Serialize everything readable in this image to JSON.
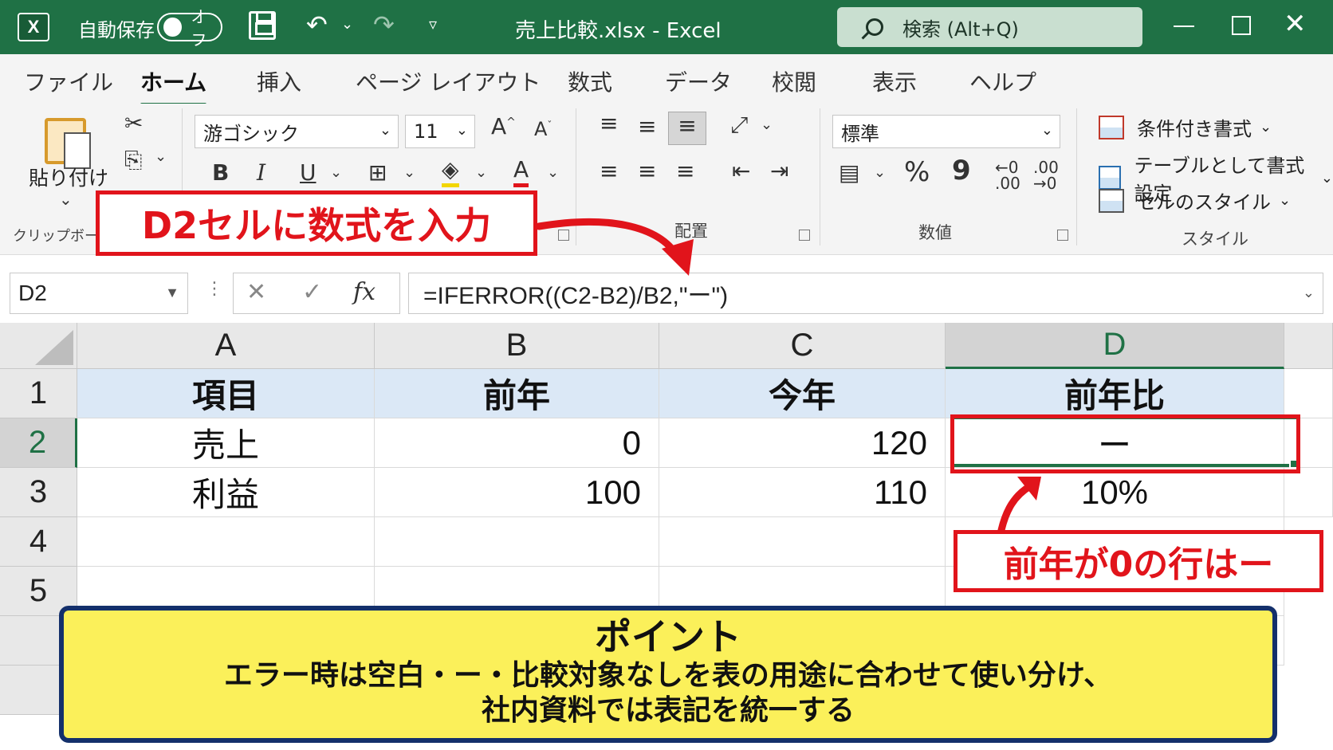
{
  "titlebar": {
    "app_icon": "X",
    "autosave_label": "自動保存",
    "autosave_state": "オフ",
    "document_title": "売上比較.xlsx  -  Excel",
    "search_placeholder": "検索 (Alt+Q)"
  },
  "ribbon": {
    "tabs": [
      "ファイル",
      "ホーム",
      "挿入",
      "ページ レイアウト",
      "数式",
      "データ",
      "校閲",
      "表示",
      "ヘルプ"
    ],
    "active_tab": "ホーム",
    "clipboard": {
      "paste_label": "貼り付け",
      "group_label": "クリップボード"
    },
    "font": {
      "font_name": "游ゴシック",
      "font_size": "11",
      "bold": "B",
      "italic": "I",
      "underline": "U"
    },
    "alignment": {
      "group_label": "配置"
    },
    "number": {
      "format": "標準",
      "percent": "%",
      "comma": "9",
      "group_label": "数値"
    },
    "styles": {
      "conditional_formatting": "条件付き書式",
      "format_as_table": "テーブルとして書式設定",
      "cell_styles": "セルのスタイル",
      "group_label": "スタイル"
    }
  },
  "formula_bar": {
    "name_box": "D2",
    "fx_label": "fx",
    "formula": "=IFERROR((C2-B2)/B2,\"ー\")"
  },
  "sheet": {
    "columns": [
      "A",
      "B",
      "C",
      "D"
    ],
    "rows": [
      "1",
      "2",
      "3",
      "4",
      "5"
    ],
    "selected_cell": "D2",
    "header_row": [
      "項目",
      "前年",
      "今年",
      "前年比"
    ],
    "data_rows": [
      [
        "売上",
        "0",
        "120",
        "ー"
      ],
      [
        "利益",
        "100",
        "110",
        "10%"
      ]
    ]
  },
  "annotations": {
    "formula_callout": "D2セルに数式を入力",
    "result_callout": "前年が0の行はー",
    "point_title": "ポイント",
    "point_line1": "エラー時は空白・ー・比較対象なしを表の用途に合わせて使い分け、",
    "point_line2": "社内資料では表記を統一する",
    "accent_red": "#e1141b",
    "excel_green": "#1f7145",
    "point_bg": "#fbf05a",
    "point_border": "#14306b"
  }
}
